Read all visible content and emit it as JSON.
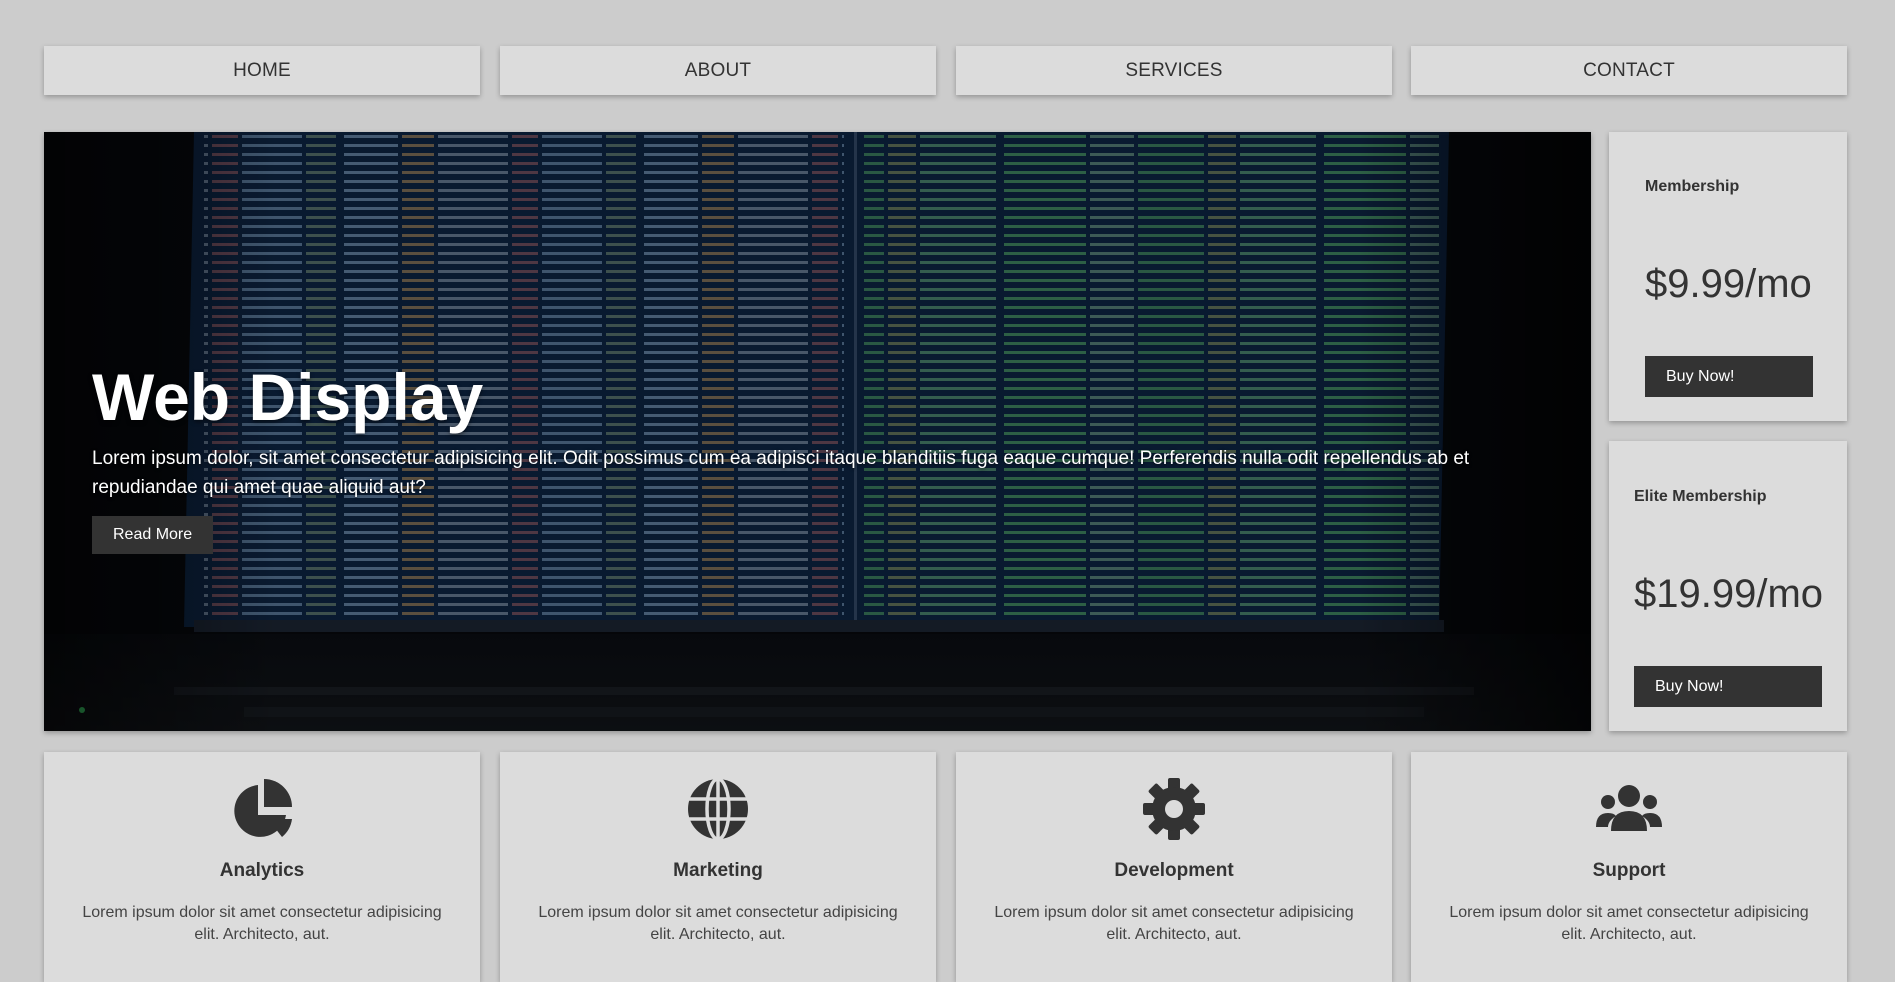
{
  "nav": {
    "items": [
      {
        "label": "HOME"
      },
      {
        "label": "ABOUT"
      },
      {
        "label": "SERVICES"
      },
      {
        "label": "CONTACT"
      }
    ]
  },
  "hero": {
    "title": "Web Display",
    "text": "Lorem ipsum dolor, sit amet consectetur adipisicing elit. Odit possimus cum ea adipisci itaque blanditiis fuga eaque cumque! Perferendis nulla odit repellendus ab et repudiandae qui amet quae aliquid aut?",
    "button": "Read More"
  },
  "plans": [
    {
      "title": "Membership",
      "price": "$9.99/mo",
      "button": "Buy Now!"
    },
    {
      "title": "Elite Membership",
      "price": "$19.99/mo",
      "button": "Buy Now!"
    }
  ],
  "features": [
    {
      "icon": "chart-pie-icon",
      "title": "Analytics",
      "text": "Lorem ipsum dolor sit amet consectetur adipisicing elit. Architecto, aut."
    },
    {
      "icon": "globe-icon",
      "title": "Marketing",
      "text": "Lorem ipsum dolor sit amet consectetur adipisicing elit. Architecto, aut."
    },
    {
      "icon": "cog-icon",
      "title": "Development",
      "text": "Lorem ipsum dolor sit amet consectetur adipisicing elit. Architecto, aut."
    },
    {
      "icon": "users-icon",
      "title": "Support",
      "text": "Lorem ipsum dolor sit amet consectetur adipisicing elit. Architecto, aut."
    }
  ],
  "colors": {
    "background": "#cccccc",
    "card": "#dcdcdc",
    "button": "#333333",
    "text": "#333333",
    "hero_overlay": "#05070b"
  }
}
